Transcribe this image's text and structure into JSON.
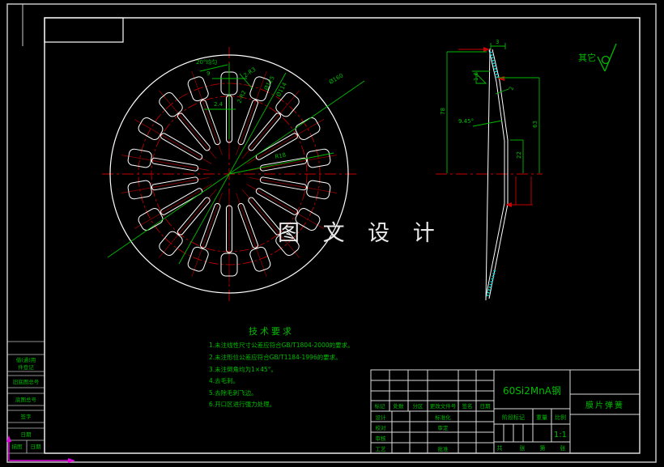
{
  "watermark": "图 文 设 计",
  "surface_note": {
    "label": "其它"
  },
  "front_view": {
    "dim_angle": "20°均匀",
    "dim_width": "9",
    "dim_tip_radius": "2-R3",
    "dim_root_radius": "2-R2",
    "dim_slot": "2.4",
    "dim_d1": "Ø125",
    "dim_d2": "Ø114",
    "dim_d3": "Ø160",
    "dim_r": "R18"
  },
  "side_view": {
    "dim_top": "3",
    "dim_thickness": "1.6",
    "dim_step": "2",
    "dim_height": "78",
    "dim_angle": "9.45°",
    "dim_h2": "63",
    "dim_h3": "22"
  },
  "tech_requirements": {
    "title": "技术要求",
    "items": [
      "1.未注线性尺寸公差应符合GB/T1804-2000的要求。",
      "2.未注形位公差应符合GB/T1184-1996的要求。",
      "3.未注倒角均为1×45°。",
      "4.去毛刺。",
      "5.去除毛刺飞边。",
      "6.开口区进行强力处理。"
    ]
  },
  "title_block": {
    "material": "60Si2MnA钢",
    "part_name": "膜片弹簧",
    "rev_header": [
      "标记",
      "处数",
      "分区",
      "更改文件号",
      "签名",
      "日期"
    ],
    "sign_rows": [
      "设计",
      "校对",
      "审核",
      "工艺"
    ],
    "approve_rows": [
      "标准化",
      "审定",
      "批准"
    ],
    "stage_label": "阶段标记",
    "weight_label": "重量",
    "scale_label": "比例",
    "scale_value": "1:1",
    "sheet_labels": [
      "共",
      "张",
      "第",
      "张"
    ]
  },
  "margin_strip": {
    "row1a": "借(通)用",
    "row1b": "件登记",
    "row2": "旧底图总号",
    "row3": "底图总号",
    "row4": "签字",
    "row5": "日期",
    "bottom_left": "描图",
    "bottom_right": "日期"
  }
}
